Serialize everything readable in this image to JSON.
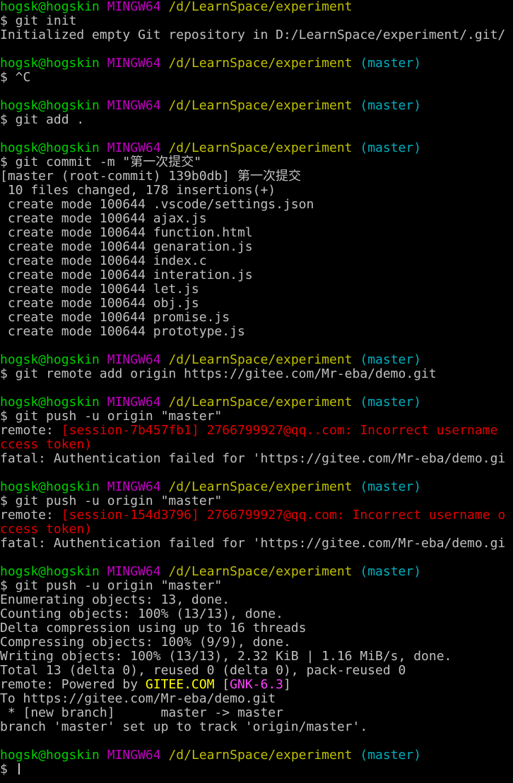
{
  "colors": {
    "default": "#c0c0c0",
    "user": "#00d000",
    "mingw": "#c000c0",
    "path": "#c0c000",
    "branch": "#00b0c0",
    "error": "#e00000",
    "gitee": "#ffff00",
    "gnk": "#ff40ff",
    "cursor": "#c0c0c0"
  },
  "lines": [
    [
      [
        "hogsk@hogskin",
        "user"
      ],
      [
        " ",
        "default"
      ],
      [
        "MINGW64",
        "mingw"
      ],
      [
        " ",
        "default"
      ],
      [
        "/d/LearnSpace/experiment",
        "path"
      ]
    ],
    [
      [
        "$ git init",
        "default"
      ]
    ],
    [
      [
        "Initialized empty Git repository in D:/LearnSpace/experiment/.git/",
        "default"
      ]
    ],
    [],
    [
      [
        "hogsk@hogskin",
        "user"
      ],
      [
        " ",
        "default"
      ],
      [
        "MINGW64",
        "mingw"
      ],
      [
        " ",
        "default"
      ],
      [
        "/d/LearnSpace/experiment",
        "path"
      ],
      [
        " ",
        "default"
      ],
      [
        "(master)",
        "branch"
      ]
    ],
    [
      [
        "$ ^C",
        "default"
      ]
    ],
    [],
    [
      [
        "hogsk@hogskin",
        "user"
      ],
      [
        " ",
        "default"
      ],
      [
        "MINGW64",
        "mingw"
      ],
      [
        " ",
        "default"
      ],
      [
        "/d/LearnSpace/experiment",
        "path"
      ],
      [
        " ",
        "default"
      ],
      [
        "(master)",
        "branch"
      ]
    ],
    [
      [
        "$ git add .",
        "default"
      ]
    ],
    [],
    [
      [
        "hogsk@hogskin",
        "user"
      ],
      [
        " ",
        "default"
      ],
      [
        "MINGW64",
        "mingw"
      ],
      [
        " ",
        "default"
      ],
      [
        "/d/LearnSpace/experiment",
        "path"
      ],
      [
        " ",
        "default"
      ],
      [
        "(master)",
        "branch"
      ]
    ],
    [
      [
        "$ git commit -m \"第一次提交\"",
        "default"
      ]
    ],
    [
      [
        "[master (root-commit) 139b0db] 第一次提交",
        "default"
      ]
    ],
    [
      [
        " 10 files changed, 178 insertions(+)",
        "default"
      ]
    ],
    [
      [
        " create mode 100644 .vscode/settings.json",
        "default"
      ]
    ],
    [
      [
        " create mode 100644 ajax.js",
        "default"
      ]
    ],
    [
      [
        " create mode 100644 function.html",
        "default"
      ]
    ],
    [
      [
        " create mode 100644 genaration.js",
        "default"
      ]
    ],
    [
      [
        " create mode 100644 index.c",
        "default"
      ]
    ],
    [
      [
        " create mode 100644 interation.js",
        "default"
      ]
    ],
    [
      [
        " create mode 100644 let.js",
        "default"
      ]
    ],
    [
      [
        " create mode 100644 obj.js",
        "default"
      ]
    ],
    [
      [
        " create mode 100644 promise.js",
        "default"
      ]
    ],
    [
      [
        " create mode 100644 prototype.js",
        "default"
      ]
    ],
    [],
    [
      [
        "hogsk@hogskin",
        "user"
      ],
      [
        " ",
        "default"
      ],
      [
        "MINGW64",
        "mingw"
      ],
      [
        " ",
        "default"
      ],
      [
        "/d/LearnSpace/experiment",
        "path"
      ],
      [
        " ",
        "default"
      ],
      [
        "(master)",
        "branch"
      ]
    ],
    [
      [
        "$ git remote add origin https://gitee.com/Mr-eba/demo.git",
        "default"
      ]
    ],
    [],
    [
      [
        "hogsk@hogskin",
        "user"
      ],
      [
        " ",
        "default"
      ],
      [
        "MINGW64",
        "mingw"
      ],
      [
        " ",
        "default"
      ],
      [
        "/d/LearnSpace/experiment",
        "path"
      ],
      [
        " ",
        "default"
      ],
      [
        "(master)",
        "branch"
      ]
    ],
    [
      [
        "$ git push -u origin \"master\"",
        "default"
      ]
    ],
    [
      [
        "remote: ",
        "default"
      ],
      [
        "[session-7b457fb1] 2766799927@qq..com: Incorrect username",
        "error"
      ]
    ],
    [
      [
        "ccess token)",
        "error"
      ]
    ],
    [
      [
        "fatal: Authentication failed for 'https://gitee.com/Mr-eba/demo.gi",
        "default"
      ]
    ],
    [],
    [
      [
        "hogsk@hogskin",
        "user"
      ],
      [
        " ",
        "default"
      ],
      [
        "MINGW64",
        "mingw"
      ],
      [
        " ",
        "default"
      ],
      [
        "/d/LearnSpace/experiment",
        "path"
      ],
      [
        " ",
        "default"
      ],
      [
        "(master)",
        "branch"
      ]
    ],
    [
      [
        "$ git push -u origin \"master\"",
        "default"
      ]
    ],
    [
      [
        "remote: ",
        "default"
      ],
      [
        "[session-154d3796] 2766799927@qq.com: Incorrect username o",
        "error"
      ]
    ],
    [
      [
        "ccess token)",
        "error"
      ]
    ],
    [
      [
        "fatal: Authentication failed for 'https://gitee.com/Mr-eba/demo.gi",
        "default"
      ]
    ],
    [],
    [
      [
        "hogsk@hogskin",
        "user"
      ],
      [
        " ",
        "default"
      ],
      [
        "MINGW64",
        "mingw"
      ],
      [
        " ",
        "default"
      ],
      [
        "/d/LearnSpace/experiment",
        "path"
      ],
      [
        " ",
        "default"
      ],
      [
        "(master)",
        "branch"
      ]
    ],
    [
      [
        "$ git push -u origin \"master\"",
        "default"
      ]
    ],
    [
      [
        "Enumerating objects: 13, done.",
        "default"
      ]
    ],
    [
      [
        "Counting objects: 100% (13/13), done.",
        "default"
      ]
    ],
    [
      [
        "Delta compression using up to 16 threads",
        "default"
      ]
    ],
    [
      [
        "Compressing objects: 100% (9/9), done.",
        "default"
      ]
    ],
    [
      [
        "Writing objects: 100% (13/13), 2.32 KiB | 1.16 MiB/s, done.",
        "default"
      ]
    ],
    [
      [
        "Total 13 (delta 0), reused 0 (delta 0), pack-reused 0",
        "default"
      ]
    ],
    [
      [
        "remote: Powered by ",
        "default"
      ],
      [
        "GITEE.COM",
        "gitee"
      ],
      [
        " [",
        "default"
      ],
      [
        "GNK-6.3",
        "gnk"
      ],
      [
        "]",
        "default"
      ]
    ],
    [
      [
        "To https://gitee.com/Mr-eba/demo.git",
        "default"
      ]
    ],
    [
      [
        " * [new branch]      master -> master",
        "default"
      ]
    ],
    [
      [
        "branch 'master' set up to track 'origin/master'.",
        "default"
      ]
    ],
    [],
    [
      [
        "hogsk@hogskin",
        "user"
      ],
      [
        " ",
        "default"
      ],
      [
        "MINGW64",
        "mingw"
      ],
      [
        " ",
        "default"
      ],
      [
        "/d/LearnSpace/experiment",
        "path"
      ],
      [
        " ",
        "default"
      ],
      [
        "(master)",
        "branch"
      ]
    ],
    [
      [
        "$ ",
        "default"
      ]
    ]
  ]
}
